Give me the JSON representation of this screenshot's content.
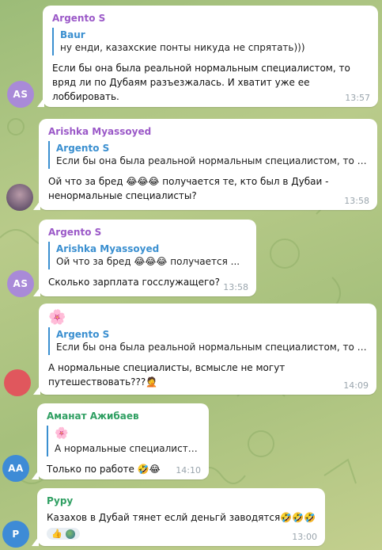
{
  "messages": [
    {
      "sender": "Argento S",
      "sender_color": "#9b59c8",
      "reply": {
        "name": "Baur",
        "text": "ну енди, казахские понты никуда не спрятать)))"
      },
      "text": "Если бы она была реальной нормальным специалистом, то вряд ли по Дубаям разъезжалась. И хватит уже ее лоббировать.",
      "time": "13:57",
      "avatar": {
        "initials": "AS",
        "color": "#a98ad8"
      }
    },
    {
      "sender": "Arishka Myassoyed",
      "sender_color": "#9b59c8",
      "reply": {
        "name": "Argento S",
        "text": "Если бы она была реальной нормальным специалистом, то в..."
      },
      "text": "Ой что за бред 😂😂😂 получается те, кто был в Дубаи - ненормальные специалисты?",
      "time": "13:58",
      "avatar": {
        "initials": "",
        "color": "#6d5a7c"
      }
    },
    {
      "sender": "Argento S",
      "sender_color": "#9b59c8",
      "reply": {
        "name": "Arishka Myassoyed",
        "text": "Ой что за бред 😂😂😂 получается ..."
      },
      "text": "Сколько зарплата госслужащего?",
      "time": "13:58",
      "avatar": {
        "initials": "AS",
        "color": "#a98ad8"
      }
    },
    {
      "sender": "🌸",
      "reply": {
        "name": "Argento S",
        "text": "Если бы она была реальной нормальным специалистом, то в..."
      },
      "text": "А нормальные специалисты, всмысле не могут путешествовать???🤦",
      "time": "14:09",
      "avatar": {
        "initials": "",
        "color": "#e0575d"
      }
    },
    {
      "sender": "Аманат Ажибаев",
      "sender_color": "#2f9f62",
      "reply": {
        "name": "🌸",
        "text": "А нормальные специалисты..."
      },
      "text": "Только по работе 🤣😂",
      "time": "14:10",
      "avatar": {
        "initials": "AA",
        "color": "#3e8bd6"
      }
    },
    {
      "sender": "Pypy",
      "sender_color": "#2f9f62",
      "text": "Казахов в Дубай тянет еслй деньгй заводятся🤣🤣🤣",
      "reactions": "👍",
      "time": "13:00",
      "avatar": {
        "initials": "P",
        "color": "#3e8bd6"
      }
    }
  ]
}
